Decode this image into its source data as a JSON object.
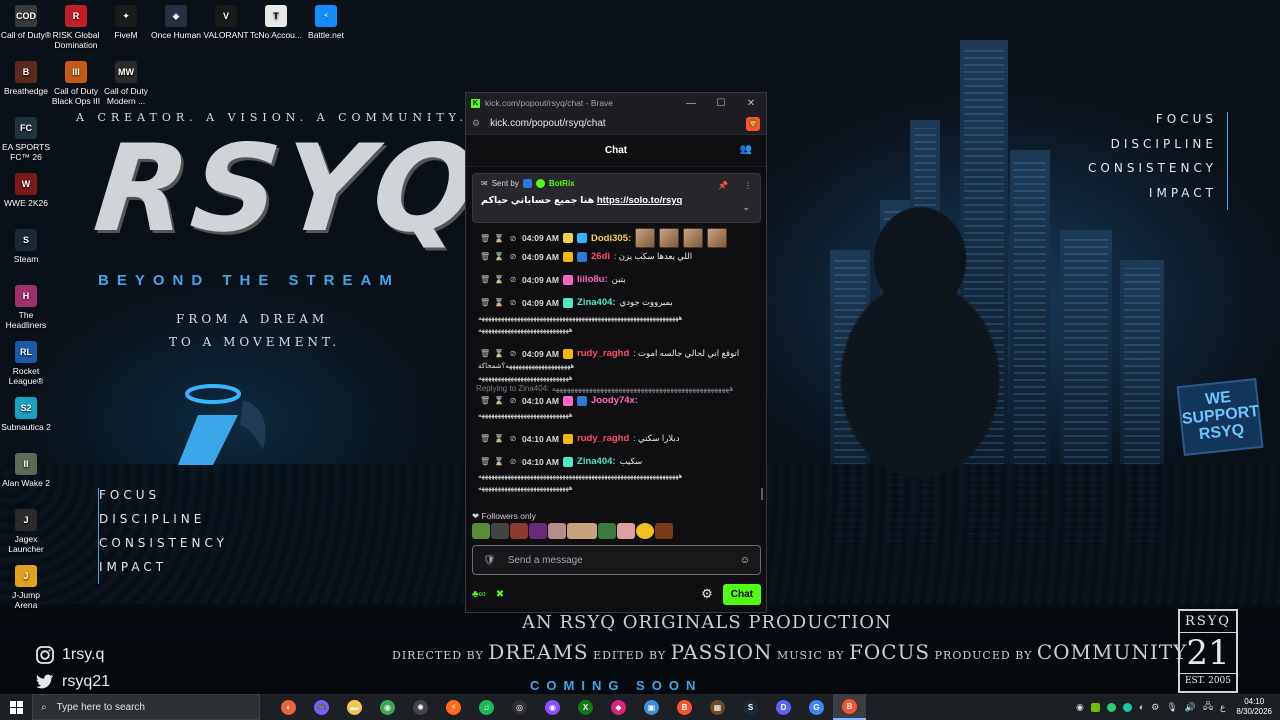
{
  "wallpaper": {
    "tagline": "A CREATOR. A VISION. A COMMUNITY.",
    "logo": "RSYQ",
    "subtitle": "BEYOND THE STREAM",
    "dream_line1": "FROM A DREAM",
    "dream_line2": "TO A MOVEMENT.",
    "left_values": [
      "FOCUS",
      "DISCIPLINE",
      "CONSISTENCY",
      "IMPACT"
    ],
    "right_values": [
      "FOCUS",
      "DISCIPLINE",
      "CONSISTENCY",
      "IMPACT"
    ],
    "originals": "AN RSYQ ORIGINALS PRODUCTION",
    "credits": {
      "directed_label": "DIRECTED BY",
      "directed": "DREAMS",
      "edited_label": "EDITED BY",
      "edited": "PASSION",
      "music_label": "MUSIC BY",
      "music": "FOCUS",
      "produced_label": "PRODUCED BY",
      "produced": "COMMUNITY"
    },
    "coming_soon": "COMING SOON",
    "instagram": "1rsy.q",
    "twitter": "rsyq21",
    "badge_top": "RSYQ",
    "badge_number": "21",
    "badge_est": "EST. 2005",
    "sign_text": "WE SUPPORT RSYQ"
  },
  "desktop_icons": [
    {
      "label": "Call of Duty®",
      "icon": "cod-icon",
      "color": "#3a3a3a",
      "glyph": "COD"
    },
    {
      "label": "RISK Global Domination",
      "icon": "risk-icon",
      "color": "#c0202a",
      "glyph": "R"
    },
    {
      "label": "FiveM",
      "icon": "fivem-icon",
      "color": "#1c1c1c",
      "glyph": "✦"
    },
    {
      "label": "Once Human",
      "icon": "once-human-icon",
      "color": "#2b2f45",
      "glyph": "◆"
    },
    {
      "label": "VALORANT",
      "icon": "valorant-icon",
      "color": "#1a1a1a",
      "glyph": "V"
    },
    {
      "label": "TcNo Accou...",
      "icon": "tcno-icon",
      "color": "#e8e8e8",
      "glyph": "T"
    },
    {
      "label": "Battle.net",
      "icon": "battlenet-icon",
      "color": "#148eff",
      "glyph": "⚡"
    },
    {
      "label": "Breathedge",
      "icon": "breathedge-icon",
      "color": "#5a2b1c",
      "glyph": "B"
    },
    {
      "label": "Call of Duty Black Ops III",
      "icon": "bo3-icon",
      "color": "#c45a10",
      "glyph": "III"
    },
    {
      "label": "Call of Duty Modern ...",
      "icon": "mw-icon",
      "color": "#2a2a2a",
      "glyph": "MW"
    },
    {
      "label": "EA SPORTS FC™ 26",
      "icon": "easports-icon",
      "color": "#20343e",
      "glyph": "FC"
    },
    {
      "label": "WWE 2K26",
      "icon": "wwe-icon",
      "color": "#7a1a1a",
      "glyph": "W"
    },
    {
      "label": "Steam",
      "icon": "steam-icon",
      "color": "#1b2838",
      "glyph": "S"
    },
    {
      "label": "The Headliners",
      "icon": "headliners-icon",
      "color": "#a0306a",
      "glyph": "H"
    },
    {
      "label": "Rocket League®",
      "icon": "rocket-league-icon",
      "color": "#1c5aa8",
      "glyph": "RL"
    },
    {
      "label": "Subnautica 2",
      "icon": "subnautica-icon",
      "color": "#1aa0c0",
      "glyph": "S2"
    },
    {
      "label": "Alan Wake 2",
      "icon": "alan-wake-icon",
      "color": "#5b6b55",
      "glyph": "II"
    },
    {
      "label": "Jagex Launcher",
      "icon": "jagex-icon",
      "color": "#2a2a2a",
      "glyph": "J"
    },
    {
      "label": "J-Jump Arena",
      "icon": "jjump-icon",
      "color": "#e0a020",
      "glyph": "J"
    }
  ],
  "browser": {
    "window_title": "kick.com/popout/rsyq/chat - Brave",
    "address": "kick.com/popout/rsyq/chat",
    "chat_title": "Chat",
    "pinned": {
      "sent_by_label": "Sent by",
      "sender": "BotRix",
      "text": "هنا جميع حساباتي حياكم",
      "link": "https://solo.to/rsyq"
    },
    "messages": [
      {
        "time": "04:09 AM",
        "user": "Dodi305:",
        "user_color": "#f6d04d",
        "text": "",
        "badge_color": "#f6d04d",
        "badge2_color": "#2eb7ff",
        "emotes": 4
      },
      {
        "time": "04:09 AM",
        "user": "26di",
        "user_color": "#ff4d6a",
        "text": ": اللي يعدها سكب يزن",
        "badge_color": "#f6b800",
        "badge2_color": "#2d7ad6",
        "emotes": 0
      },
      {
        "time": "04:09 AM",
        "user": "liilo8u:",
        "user_color": "#ff66c4",
        "text": "يتبن",
        "badge_color": "#ff66c4",
        "badge2_color": "",
        "emotes": 0
      },
      {
        "time": "04:09 AM",
        "user": "Zina404:",
        "user_color": "#4ee7c8",
        "text": "بمبرووت جودي",
        "badge_color": "#4ee7c8",
        "badge2_color": "",
        "emotes": 0
      },
      {
        "time": "04:09 AM",
        "user": "rudy_raghd",
        "user_color": "#ff4d6a",
        "text": ": اتوقع اني لحالي جالسه اموت",
        "badge_color": "#f6b800",
        "badge2_color": "",
        "emotes": 0
      },
      {
        "time": "04:10 AM",
        "user": "Joody74x:",
        "user_color": "#ff66c4",
        "text": "",
        "badge_color": "#ff66c4",
        "badge2_color": "#2d7ad6",
        "emotes": 0
      },
      {
        "time": "04:10 AM",
        "user": "rudy_raghd",
        "user_color": "#ff4d6a",
        "text": ": دبلارا سكتي",
        "badge_color": "#f6b800",
        "badge2_color": "",
        "emotes": 0
      },
      {
        "time": "04:10 AM",
        "user": "Zina404:",
        "user_color": "#4ee7c8",
        "text": "سكيب",
        "badge_color": "#4ee7c8",
        "badge2_color": "",
        "emotes": 0
      }
    ],
    "spam_line": "ههههههههههههههههههههههههههههههههههههههههههههههههههههههههههههههه",
    "spam_short": "ههههههههههههههههههههههههههههه",
    "spam_short2": "ههههههههههههههههههههه؟شمحاكة",
    "reply_label": "Replying to Zina404: ههههههههههههههههههههههههههههههههههههههههههههههههه",
    "followers_only": "Followers only",
    "send_placeholder": "Send a message",
    "chat_button": "Chat",
    "infinity": "∞"
  },
  "taskbar": {
    "search_placeholder": "Type here to search",
    "apps": [
      {
        "name": "taskbar-app-chatgpt",
        "color": "#e8643c",
        "glyph": "◐"
      },
      {
        "name": "taskbar-app-gamepad",
        "color": "#7b5cff",
        "glyph": "🎮"
      },
      {
        "name": "taskbar-app-explorer",
        "color": "#f3c64e",
        "glyph": "▬"
      },
      {
        "name": "taskbar-app-chrome",
        "color": "#3aa657",
        "glyph": "◉"
      },
      {
        "name": "taskbar-app-steelseries",
        "color": "#444",
        "glyph": "✺"
      },
      {
        "name": "taskbar-app-orange",
        "color": "#ff6a1a",
        "glyph": "⚡"
      },
      {
        "name": "taskbar-app-spotify",
        "color": "#1db954",
        "glyph": "♫"
      },
      {
        "name": "taskbar-app-obs",
        "color": "#302e31",
        "glyph": "◎"
      },
      {
        "name": "taskbar-app-purple",
        "color": "#8a4fff",
        "glyph": "◉"
      },
      {
        "name": "taskbar-app-xbox",
        "color": "#107c10",
        "glyph": "X"
      },
      {
        "name": "taskbar-app-pink",
        "color": "#d7267a",
        "glyph": "◆"
      },
      {
        "name": "taskbar-app-window",
        "color": "#3b8ed8",
        "glyph": "▣"
      },
      {
        "name": "taskbar-app-brave",
        "color": "#fb542b",
        "glyph": "B"
      },
      {
        "name": "taskbar-app-minecraft",
        "color": "#6b4a2b",
        "glyph": "▦"
      },
      {
        "name": "taskbar-app-steam",
        "color": "#1b2838",
        "glyph": "S"
      },
      {
        "name": "taskbar-app-discord",
        "color": "#5865f2",
        "glyph": "D"
      },
      {
        "name": "taskbar-app-google",
        "color": "#4285f4",
        "glyph": "G"
      },
      {
        "name": "taskbar-app-brave-active",
        "color": "#fb542b",
        "glyph": "B"
      }
    ],
    "lang": "ع",
    "time": "04:10",
    "date": "8/30/2026"
  }
}
